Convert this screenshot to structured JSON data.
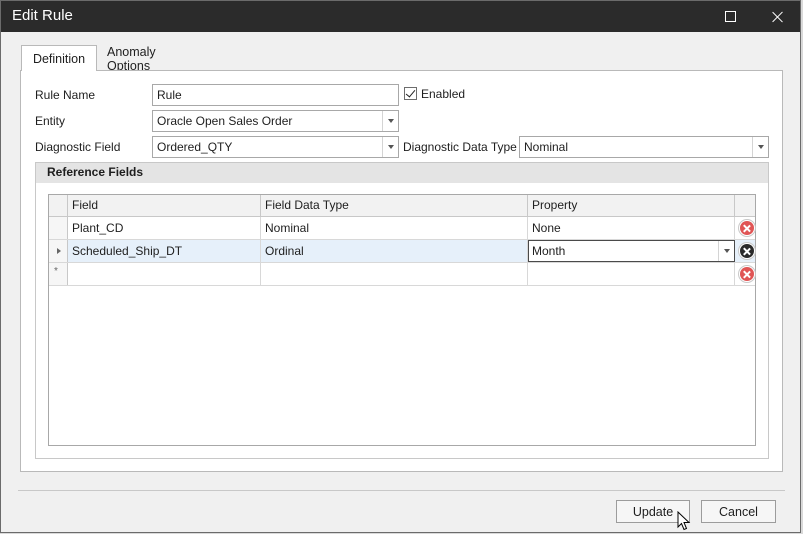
{
  "window": {
    "title": "Edit Rule"
  },
  "tabs": [
    {
      "label": "Definition",
      "active": true
    },
    {
      "label": "Anomaly Options",
      "active": false
    }
  ],
  "form": {
    "rule_name_label": "Rule Name",
    "rule_name_value": "Rule",
    "enabled_label": "Enabled",
    "enabled_checked": true,
    "entity_label": "Entity",
    "entity_value": "Oracle Open Sales Order",
    "diagnostic_field_label": "Diagnostic Field",
    "diagnostic_field_value": "Ordered_QTY",
    "diagnostic_data_type_label": "Diagnostic Data Type",
    "diagnostic_data_type_value": "Nominal"
  },
  "reference_fields": {
    "title": "Reference Fields",
    "columns": [
      "Field",
      "Field Data Type",
      "Property"
    ],
    "rows": [
      {
        "field": "Plant_CD",
        "data_type": "Nominal",
        "property": "None"
      },
      {
        "field": "Scheduled_Ship_DT",
        "data_type": "Ordinal",
        "property": "Month"
      }
    ],
    "new_row_marker": "*"
  },
  "footer": {
    "update_label": "Update",
    "cancel_label": "Cancel"
  },
  "colors": {
    "titlebar": "#2b2b2b",
    "delete_red": "#e05555",
    "selected_row": "#e6f0fa"
  }
}
